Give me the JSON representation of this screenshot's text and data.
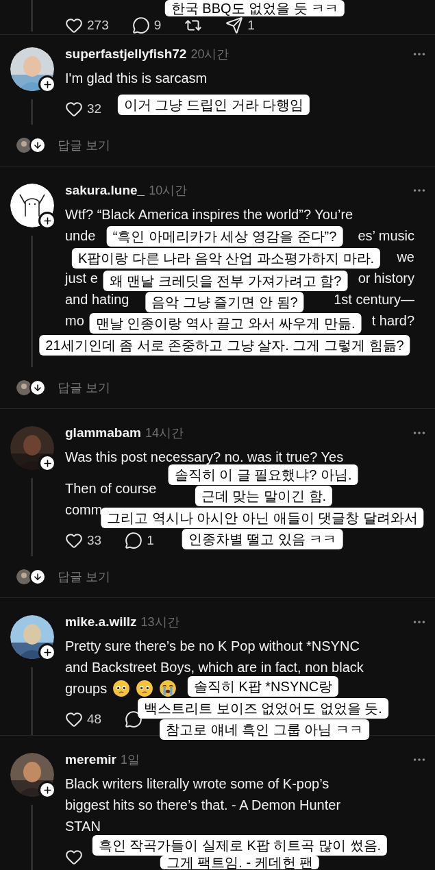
{
  "previous_post": {
    "captions": [
      "한국 BBQ도 없었을 듯 ㅋㅋ"
    ],
    "actions": [
      {
        "kind": "like",
        "count": "273"
      },
      {
        "kind": "reply",
        "count": "9"
      },
      {
        "kind": "repost"
      },
      {
        "kind": "share",
        "count": "1"
      }
    ]
  },
  "comments": [
    {
      "username": "superfastjellyfish72",
      "time": "20시간",
      "avatar": {
        "kind": "picture"
      },
      "body": [
        [
          {
            "left": "I'm glad this is sarcasm"
          }
        ]
      ],
      "actions": [
        {
          "kind": "like",
          "count": "32"
        }
      ],
      "replies_label": "답글 보기",
      "captions": [
        "이거 그냥 드립인 거라 다행임"
      ]
    },
    {
      "username": "sakura.lune_",
      "time": "10시간",
      "avatar": {
        "kind": "drawing"
      },
      "body": [
        [
          {
            "left": "Wtf? “Black America inspires the world”? You’re"
          },
          {
            "left": "unde",
            "right": "es’ music"
          },
          {
            "right": "we"
          },
          {
            "left": "just e",
            "right": "or history"
          },
          {
            "left": "and hating",
            "right": "1st century—"
          },
          {
            "left": "mo",
            "right": "t hard?"
          }
        ]
      ],
      "replies_label": "답글 보기",
      "captions": [
        "“흑인 아메리카가 세상 영감을 준다”?",
        "K팝이랑 다른 나라 음악 산업 과소평가하지 마라.",
        "왜 맨날 크레딧을 전부 가져가려고 함?",
        "음악 그냥 즐기면 안 됨?",
        "맨날 인종이랑 역사 끌고 와서 싸우게 만듦.",
        "21세기인데 좀 서로 존중하고 그냥 살자. 그게 그렇게 힘듦?"
      ]
    },
    {
      "username": "glammabam",
      "time": "14시간",
      "avatar": {
        "kind": "picture"
      },
      "body": [
        [
          {
            "left": "Was this post necessary? no. was it true? Yes"
          }
        ],
        [
          {
            "left": "Then of course"
          },
          {
            "left": "comm"
          }
        ]
      ],
      "actions": [
        {
          "kind": "like",
          "count": "33"
        },
        {
          "kind": "reply",
          "count": "1"
        }
      ],
      "replies_label": "답글 보기",
      "captions": [
        "솔직히 이 글 필요했냐? 아님.",
        "근데 맞는 말이긴 함.",
        "그리고 역시나 아시안 아닌 애들이 댓글창 달려와서",
        "인종차별 떨고 있음 ㅋㅋ"
      ]
    },
    {
      "username": "mike.a.willz",
      "time": "13시간",
      "avatar": {
        "kind": "picture"
      },
      "body": [
        [
          {
            "left": "Pretty sure there’s be no K Pop without *NSYNC"
          },
          {
            "left": "and Backstreet Boys, which are in fact, non black"
          },
          {
            "left": "groups",
            "emojis": [
              {
                "kind": "pleading"
              },
              {
                "kind": "pleading"
              },
              {
                "kind": "crying"
              }
            ]
          }
        ]
      ],
      "actions": [
        {
          "kind": "like",
          "count": "48"
        },
        {
          "kind": "reply"
        }
      ],
      "captions": [
        "솔직히 K팝 *NSYNC랑",
        "백스트리트 보이즈 없었어도 없었을 듯.",
        "참고로 얘네 흑인 그룹 아님 ㅋㅋ"
      ]
    },
    {
      "username": "meremir",
      "time": "1일",
      "avatar": {
        "kind": "picture"
      },
      "body": [
        [
          {
            "left": "Black writers literally wrote some of K-pop’s"
          },
          {
            "left": "biggest hits so there’s that. - A Demon Hunter"
          },
          {
            "left": "STAN"
          }
        ]
      ],
      "actions": [
        {
          "kind": "like"
        }
      ],
      "captions": [
        "흑인 작곡가들이 실제로 K팝 히트곡 많이 썼음.",
        "그게 팩트임. - 케데헌 팬"
      ]
    }
  ]
}
